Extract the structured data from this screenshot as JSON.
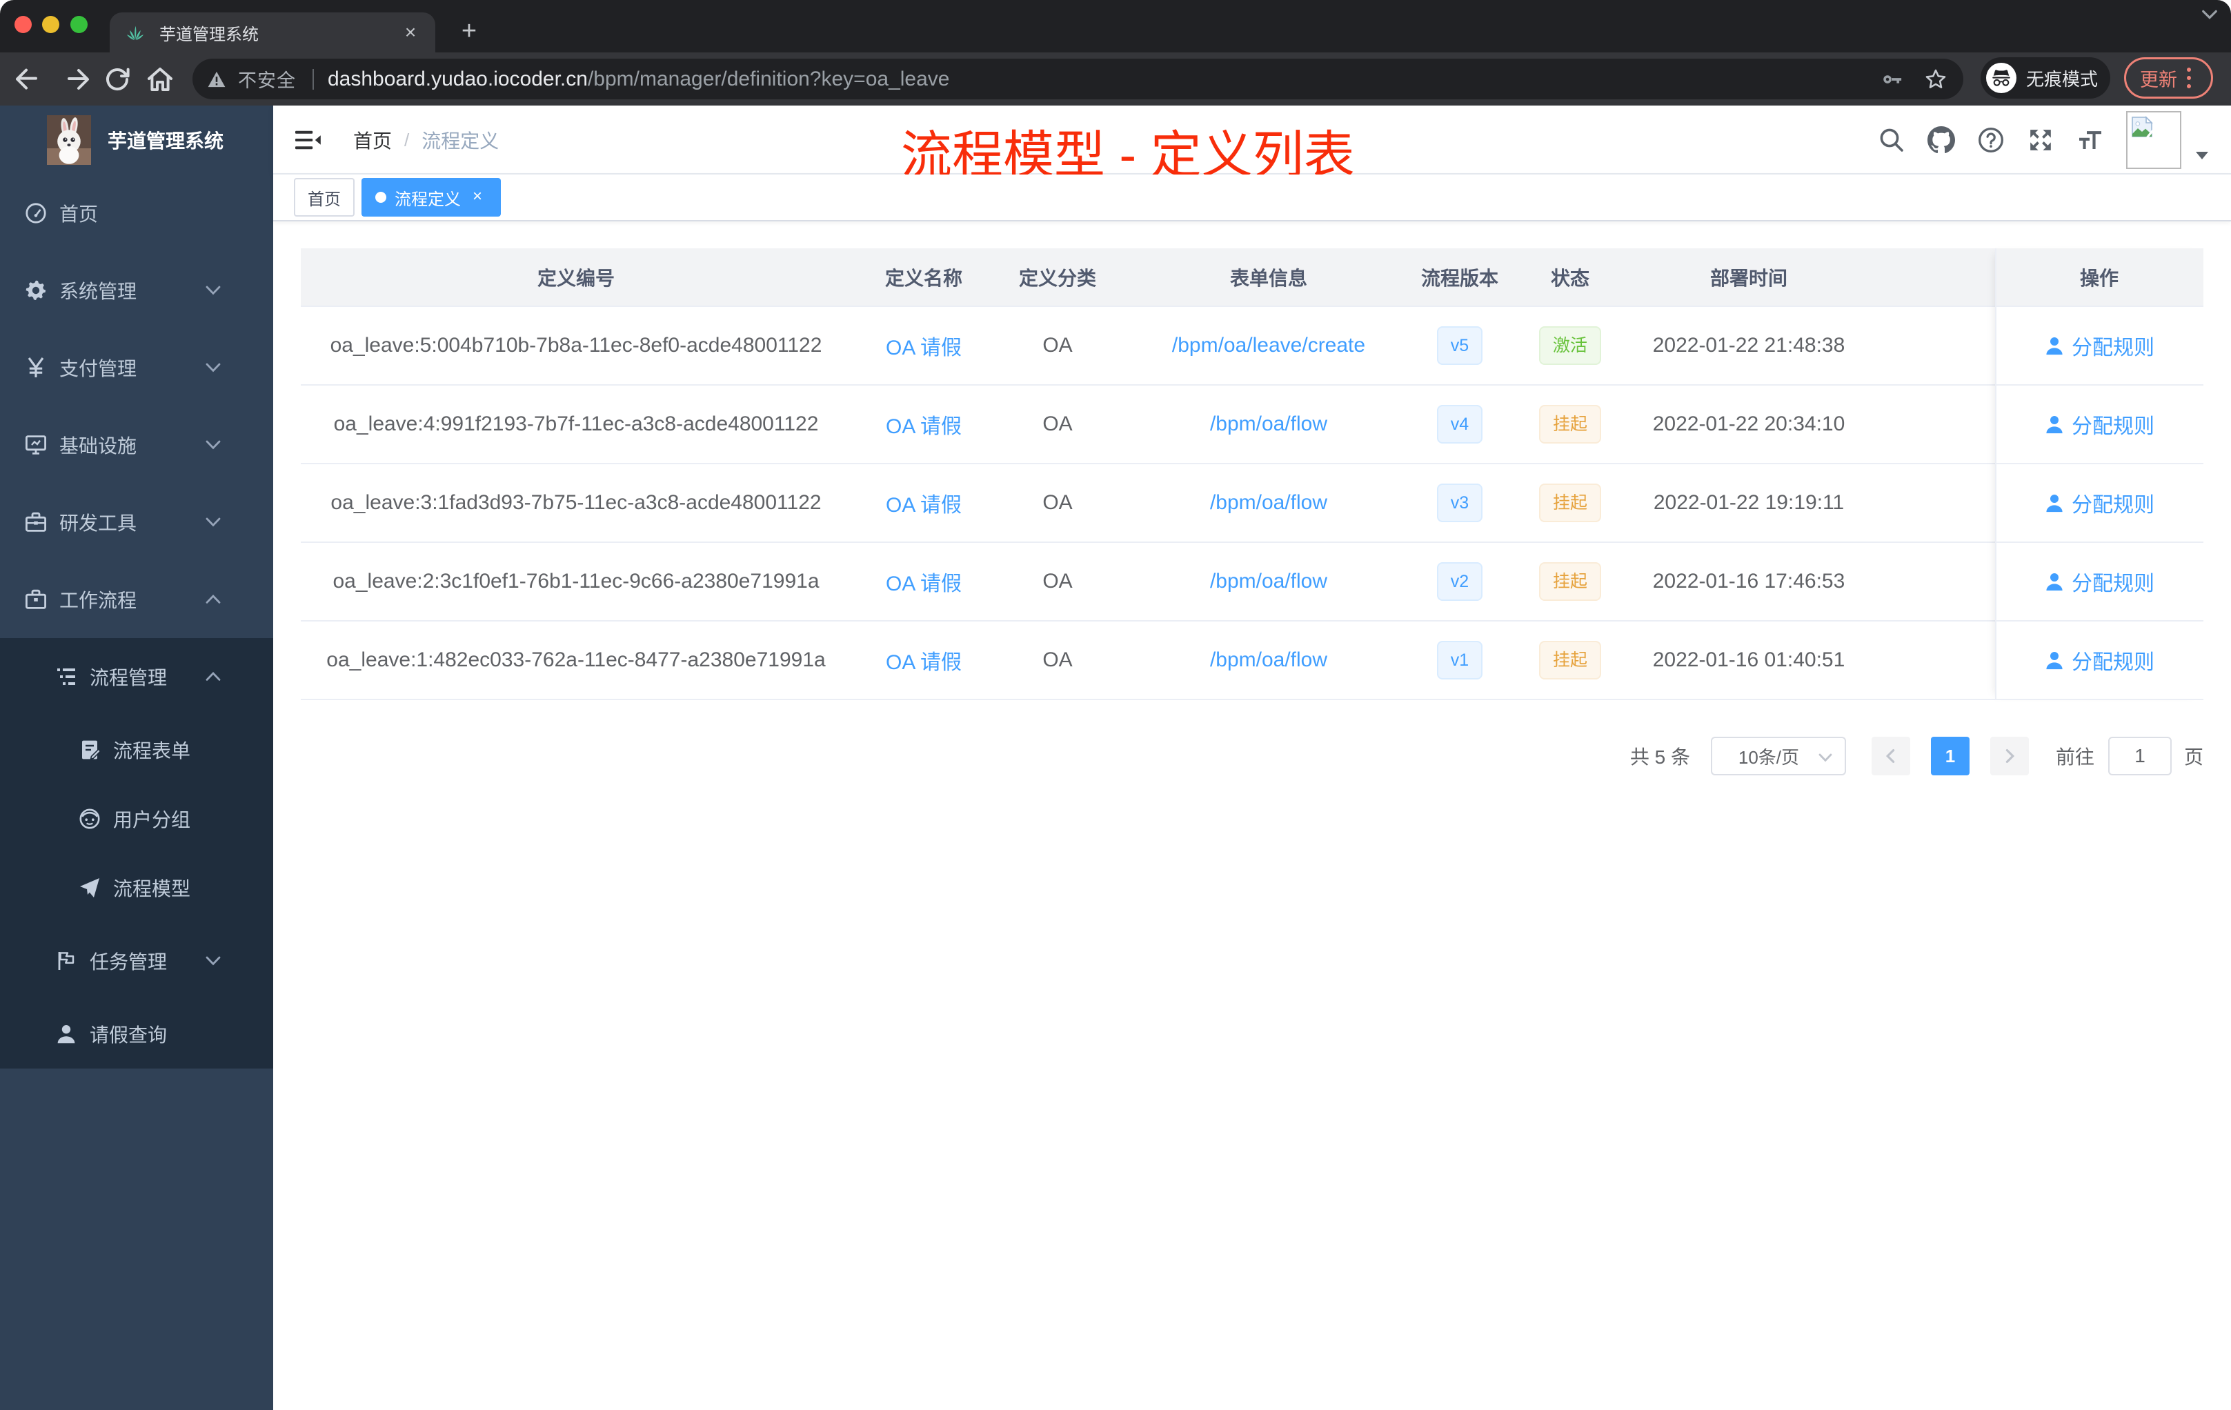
{
  "browser": {
    "tab_title": "芋道管理系统",
    "new_tab": "+",
    "close_tab": "×",
    "security_label": "不安全",
    "url_host": "dashboard.yudao.iocoder.cn",
    "url_path": "/bpm/manager/definition?key=oa_leave",
    "incognito_label": "无痕模式",
    "update_label": "更新"
  },
  "sidebar": {
    "logo_title": "芋道管理系统",
    "items": [
      {
        "label": "首页",
        "icon": "dashboard-icon",
        "level": 1,
        "arrow": "none"
      },
      {
        "label": "系统管理",
        "icon": "gear-icon",
        "level": 1,
        "arrow": "down"
      },
      {
        "label": "支付管理",
        "icon": "yuan-icon",
        "level": 1,
        "arrow": "down"
      },
      {
        "label": "基础设施",
        "icon": "monitor-icon",
        "level": 1,
        "arrow": "down"
      },
      {
        "label": "研发工具",
        "icon": "toolbox-icon",
        "level": 1,
        "arrow": "down"
      },
      {
        "label": "工作流程",
        "icon": "briefcase-icon",
        "level": 1,
        "arrow": "up"
      },
      {
        "label": "流程管理",
        "icon": "tree-list-icon",
        "level": 2,
        "arrow": "up",
        "dark": true
      },
      {
        "label": "流程表单",
        "icon": "form-icon",
        "level": 3,
        "arrow": "none",
        "dark": true
      },
      {
        "label": "用户分组",
        "icon": "user-group-icon",
        "level": 3,
        "arrow": "none",
        "dark": true
      },
      {
        "label": "流程模型",
        "icon": "send-icon",
        "level": 3,
        "arrow": "none",
        "dark": true
      },
      {
        "label": "任务管理",
        "icon": "flag-icon",
        "level": 2,
        "arrow": "down",
        "dark": true
      },
      {
        "label": "请假查询",
        "icon": "user-icon",
        "level": 2,
        "arrow": "none",
        "dark": true,
        "leaf": true
      }
    ]
  },
  "navbar": {
    "breadcrumb_home": "首页",
    "breadcrumb_sep": "/",
    "breadcrumb_current": "流程定义",
    "annotation": "流程模型 - 定义列表"
  },
  "tags": [
    {
      "label": "首页",
      "active": false
    },
    {
      "label": "流程定义",
      "active": true,
      "closable": true
    }
  ],
  "table": {
    "columns": [
      "定义编号",
      "定义名称",
      "定义分类",
      "表单信息",
      "流程版本",
      "状态",
      "部署时间",
      "操作"
    ],
    "action_label": "分配规则",
    "rows": [
      {
        "id": "oa_leave:5:004b710b-7b8a-11ec-8ef0-acde48001122",
        "name": "OA 请假",
        "category": "OA",
        "form": "/bpm/oa/leave/create",
        "version": "v5",
        "status": "激活",
        "status_type": "success",
        "deploy_time": "2022-01-22 21:48:38"
      },
      {
        "id": "oa_leave:4:991f2193-7b7f-11ec-a3c8-acde48001122",
        "name": "OA 请假",
        "category": "OA",
        "form": "/bpm/oa/flow",
        "version": "v4",
        "status": "挂起",
        "status_type": "warning",
        "deploy_time": "2022-01-22 20:34:10"
      },
      {
        "id": "oa_leave:3:1fad3d93-7b75-11ec-a3c8-acde48001122",
        "name": "OA 请假",
        "category": "OA",
        "form": "/bpm/oa/flow",
        "version": "v3",
        "status": "挂起",
        "status_type": "warning",
        "deploy_time": "2022-01-22 19:19:11"
      },
      {
        "id": "oa_leave:2:3c1f0ef1-76b1-11ec-9c66-a2380e71991a",
        "name": "OA 请假",
        "category": "OA",
        "form": "/bpm/oa/flow",
        "version": "v2",
        "status": "挂起",
        "status_type": "warning",
        "deploy_time": "2022-01-16 17:46:53"
      },
      {
        "id": "oa_leave:1:482ec033-762a-11ec-8477-a2380e71991a",
        "name": "OA 请假",
        "category": "OA",
        "form": "/bpm/oa/flow",
        "version": "v1",
        "status": "挂起",
        "status_type": "warning",
        "deploy_time": "2022-01-16 01:40:51"
      }
    ]
  },
  "pagination": {
    "total": "共 5 条",
    "page_size": "10条/页",
    "current_page": "1",
    "goto_label": "前往",
    "goto_value": "1",
    "page_unit": "页"
  },
  "colors": {
    "accent": "#409eff",
    "sidebar_bg": "#304156",
    "submenu_bg": "#1f2d3d",
    "annotation_red": "#f82d0a",
    "tag_success": "#67c23a",
    "tag_warning": "#e6a23c"
  }
}
